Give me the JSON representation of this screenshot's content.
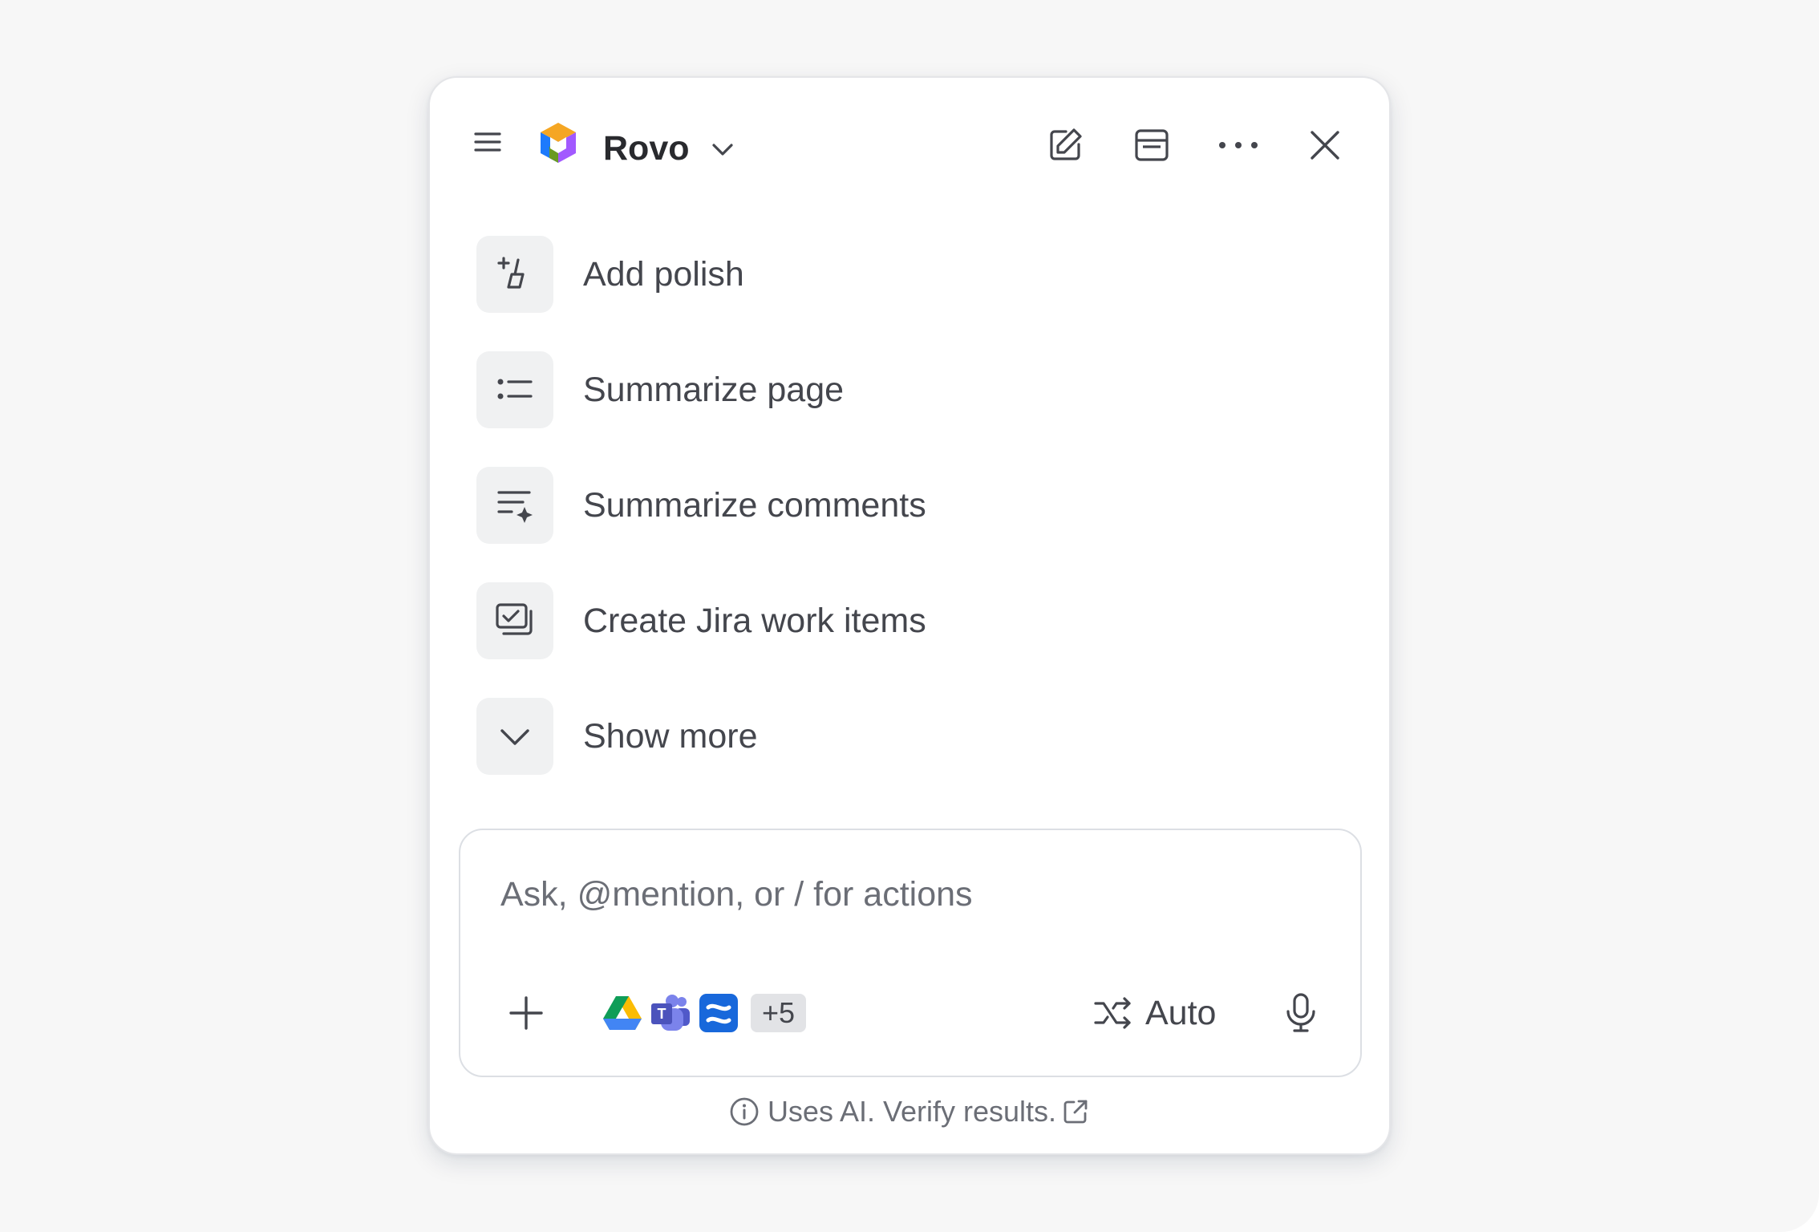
{
  "header": {
    "brand": "Rovo",
    "icons": {
      "menu": "hamburger-menu-icon",
      "logo": "rovo-logo-icon",
      "brand_chevron": "chevron-down-icon",
      "edit": "edit-icon",
      "view": "window-view-icon",
      "more": "more-icon",
      "close": "close-icon"
    }
  },
  "suggestions": [
    {
      "label": "Add polish",
      "icon": "sparkle-brush-icon"
    },
    {
      "label": "Summarize page",
      "icon": "list-icon"
    },
    {
      "label": "Summarize comments",
      "icon": "list-sparkle-icon"
    },
    {
      "label": "Create Jira work items",
      "icon": "work-items-icon"
    },
    {
      "label": "Show more",
      "icon": "chevron-down-icon"
    }
  ],
  "composer": {
    "placeholder": "Ask, @mention, or / for actions",
    "sources": [
      "google-drive-icon",
      "microsoft-teams-icon",
      "confluence-icon"
    ],
    "more_sources": "+5",
    "mode_label": "Auto",
    "mode_icon": "shuffle-icon",
    "mic_icon": "microphone-icon",
    "add_icon": "plus-icon"
  },
  "disclaimer": {
    "text": "Uses AI. Verify results.",
    "info_icon": "info-icon",
    "external_icon": "external-link-icon"
  },
  "colors": {
    "background": "#f7f7f7",
    "panel": "#ffffff",
    "text": "#44464d",
    "muted": "#6b6e76",
    "chip": "#f0f1f2"
  }
}
